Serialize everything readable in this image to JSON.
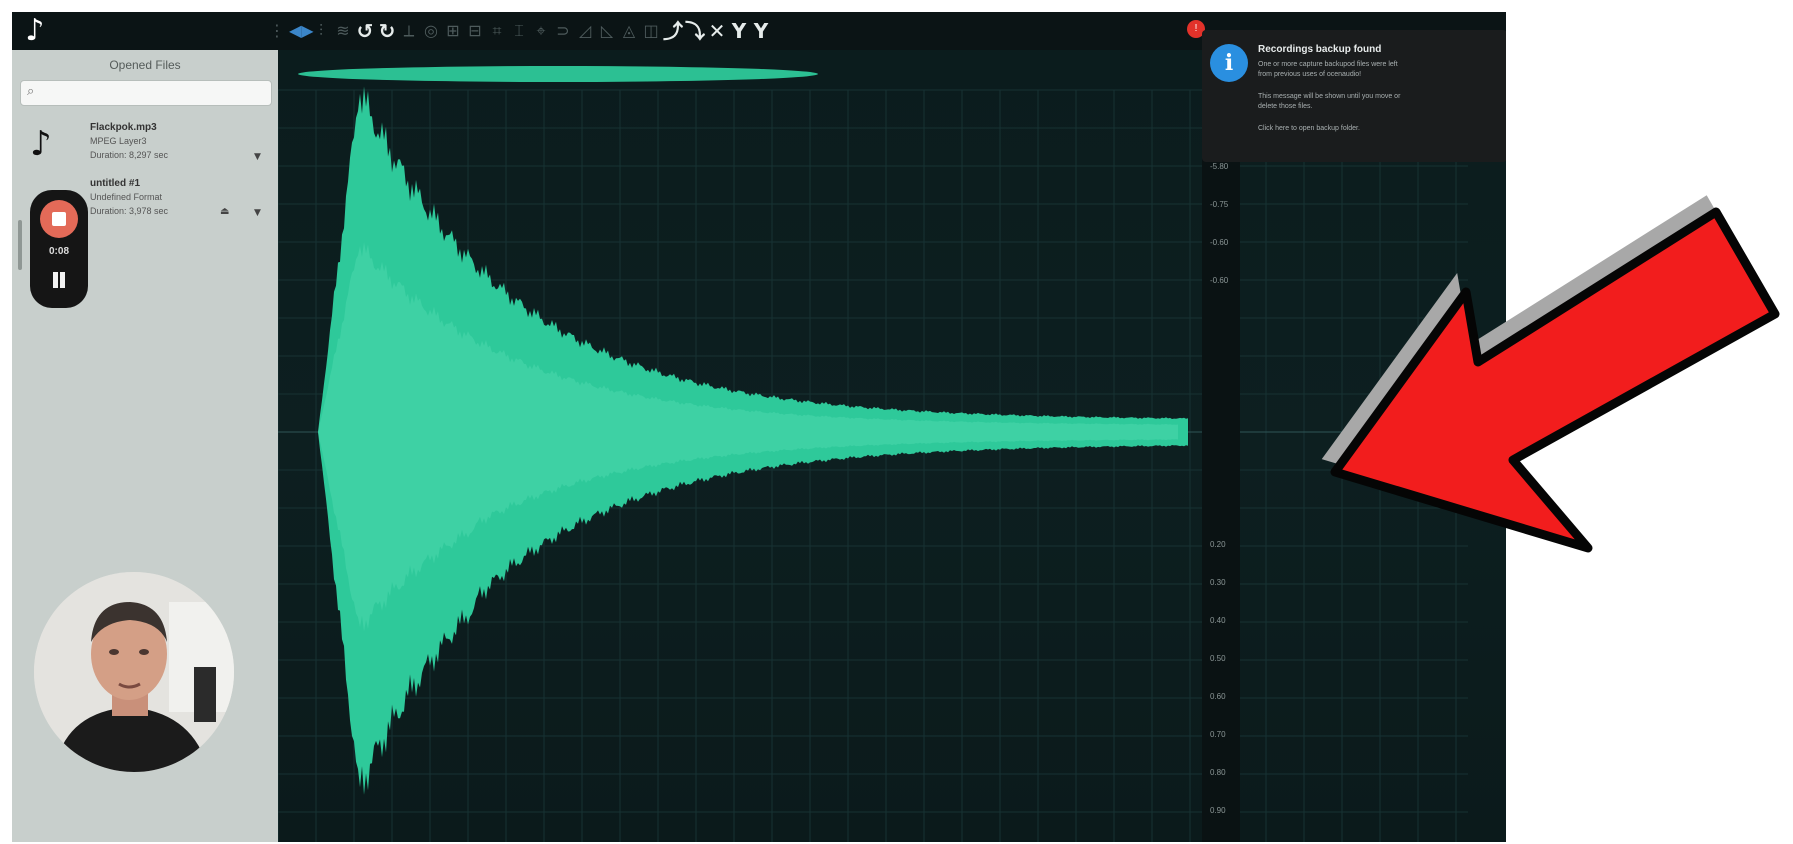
{
  "toolbar": {
    "zoom_label": "",
    "tools_left": [
      "⋮",
      "◀▶",
      "⫶",
      "≋",
      "↺",
      "↻",
      "⟂",
      "◎",
      "⊞",
      "⊟",
      "⌗",
      "⌶",
      "⌖",
      "⊃",
      "◿",
      "◺",
      "◬",
      "◫",
      "⤴",
      "⤵",
      "✕",
      "Y",
      "Y"
    ],
    "notification_count": "!"
  },
  "sidebar": {
    "title": "Opened Files",
    "search_placeholder": "",
    "files": [
      {
        "name": "Flackpok.mp3",
        "format": "MPEG Layer3",
        "duration": "Duration: 8,297 sec"
      },
      {
        "name": "untitled #1",
        "format": "Undefined Format",
        "duration": "Duration: 3,978 sec"
      }
    ]
  },
  "recorder": {
    "elapsed": "0:08"
  },
  "notification": {
    "title": "Recordings backup found",
    "body": [
      "One or more capture backupod files were left",
      "from previous uses of ocenaudio!",
      "",
      "This message will be shown until you move or",
      "delete those files.",
      "",
      "Click here to open backup folder."
    ]
  },
  "amplitude_axis": {
    "ticks": [
      "-5.80",
      "-0.75",
      "-0.60",
      "-0.60",
      "0.20",
      "0.30",
      "0.40",
      "0.50",
      "0.60",
      "0.70",
      "0.80",
      "0.90"
    ]
  },
  "colors": {
    "waveform": "#2ec99a",
    "background": "#0d1e1f",
    "arrow": "#f21d1d"
  }
}
